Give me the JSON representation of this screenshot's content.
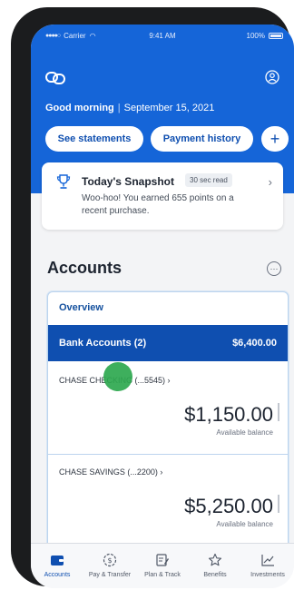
{
  "status_bar": {
    "carrier": "Carrier",
    "time": "9:41 AM",
    "battery": "100%"
  },
  "header": {
    "greeting": "Good morning",
    "date": "September 15, 2021",
    "buttons": {
      "statements": "See statements",
      "payment_history": "Payment history",
      "add": "+"
    }
  },
  "snapshot": {
    "title": "Today's Snapshot",
    "badge": "30 sec read",
    "text": "Woo-hoo! You earned 655 points on a recent purchase."
  },
  "accounts": {
    "title": "Accounts",
    "overview": "Overview",
    "group": {
      "label": "Bank Accounts (2)",
      "amount": "$6,400.00"
    },
    "items": [
      {
        "name": "CHASE CHECKING (...5545) ›",
        "balance": "$1,150.00",
        "sub": "Available balance"
      },
      {
        "name": "CHASE SAVINGS (...2200) ›",
        "balance": "$5,250.00",
        "sub": "Available balance"
      }
    ]
  },
  "tabs": [
    {
      "label": "Accounts",
      "icon": "wallet-icon"
    },
    {
      "label": "Pay & Transfer",
      "icon": "dollar-circle-icon"
    },
    {
      "label": "Plan & Track",
      "icon": "edit-note-icon"
    },
    {
      "label": "Benefits",
      "icon": "star-icon"
    },
    {
      "label": "Investments",
      "icon": "line-chart-icon"
    }
  ],
  "colors": {
    "brand_blue": "#1565d8",
    "dark_blue": "#0f4fb0",
    "tap_indicator": "#2ea84f"
  }
}
